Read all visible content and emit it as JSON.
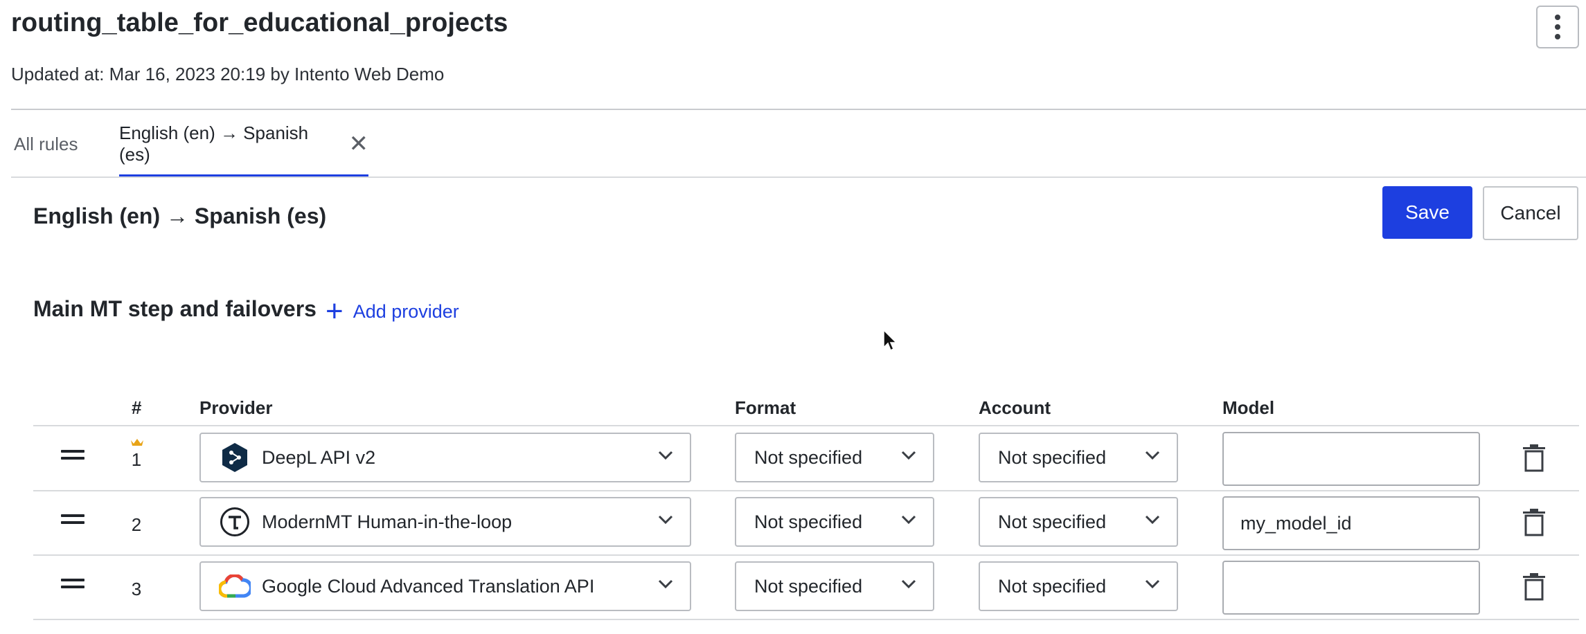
{
  "page": {
    "title": "routing_table_for_educational_projects",
    "updated": "Updated at: Mar 16, 2023 20:19 by Intento Web Demo"
  },
  "tabs": {
    "all_rules": "All rules",
    "active": "English (en) → Spanish (es)",
    "close_glyph": "✕"
  },
  "section": {
    "title": "English (en) → Spanish (es)",
    "save_label": "Save",
    "cancel_label": "Cancel"
  },
  "step": {
    "title": "Main MT step and failovers",
    "add_provider_label": "Add provider",
    "add_icon": "plus-icon"
  },
  "table": {
    "headers": {
      "num": "#",
      "provider": "Provider",
      "format": "Format",
      "account": "Account",
      "model": "Model"
    },
    "rows": [
      {
        "num": "1",
        "primary_badge_icon": "crown-icon",
        "provider": "DeepL API v2",
        "provider_icon": "deepl-logo-icon",
        "format": "Not specified",
        "account": "Not specified",
        "model": ""
      },
      {
        "num": "2",
        "provider": "ModernMT Human-in-the-loop",
        "provider_icon": "modernmt-logo-icon",
        "format": "Not specified",
        "account": "Not specified",
        "model": "my_model_id"
      },
      {
        "num": "3",
        "provider": "Google Cloud Advanced Translation API",
        "provider_icon": "google-cloud-logo-icon",
        "format": "Not specified",
        "account": "Not specified",
        "model": ""
      }
    ]
  },
  "colors": {
    "accent": "#1d3fe0",
    "crown": "#e8a417",
    "deepl": "#0f2b46"
  }
}
